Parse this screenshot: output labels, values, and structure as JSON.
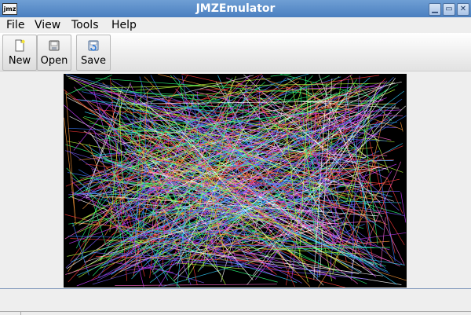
{
  "window": {
    "title": "JMZEmulator",
    "app_icon_text": "jmz",
    "controls": {
      "minimize": "▁",
      "maximize": "▭",
      "close": "✕"
    }
  },
  "menu": {
    "items": [
      {
        "label": "File"
      },
      {
        "label": "View"
      },
      {
        "label": "Tools"
      },
      {
        "label": "Help"
      }
    ]
  },
  "toolbar": {
    "buttons": [
      {
        "label": "New",
        "icon": "new-document-icon"
      },
      {
        "label": "Open",
        "icon": "open-icon"
      },
      {
        "label": "Save",
        "icon": "save-icon"
      }
    ]
  },
  "emulator": {
    "background": "#000000",
    "palette": [
      "#ff3b3b",
      "#ff66cc",
      "#7a5cff",
      "#3b7bff",
      "#33d1ff",
      "#2bff7a",
      "#b7ff3b",
      "#ffffff",
      "#ff9a3b",
      "#c83bff"
    ]
  },
  "status": {
    "text": ""
  }
}
